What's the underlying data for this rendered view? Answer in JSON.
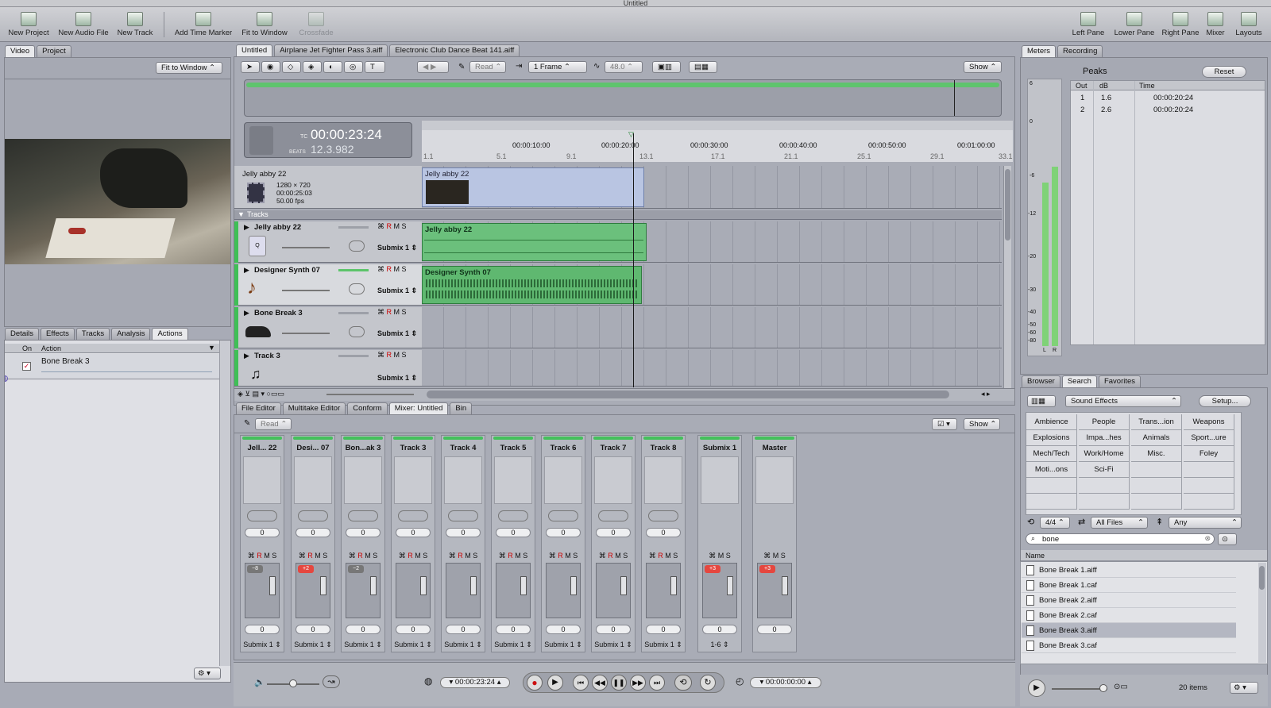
{
  "window": {
    "title": "Untitled"
  },
  "toolbar": [
    {
      "label": "New Project",
      "enabled": true,
      "icon": "new-project-icon"
    },
    {
      "label": "New Audio File",
      "enabled": true,
      "icon": "new-audio-file-icon"
    },
    {
      "label": "New Track",
      "enabled": true,
      "icon": "new-track-icon"
    },
    {
      "label": "Add Time Marker",
      "enabled": true,
      "icon": "time-marker-icon"
    },
    {
      "label": "Fit to Window",
      "enabled": true,
      "icon": "fit-window-icon"
    },
    {
      "label": "Crossfade",
      "enabled": false,
      "icon": "crossfade-icon"
    },
    {
      "label": "Left Pane",
      "enabled": true,
      "icon": "left-pane-icon"
    },
    {
      "label": "Lower Pane",
      "enabled": true,
      "icon": "lower-pane-icon"
    },
    {
      "label": "Right Pane",
      "enabled": true,
      "icon": "right-pane-icon"
    },
    {
      "label": "Mixer",
      "enabled": true,
      "icon": "mixer-icon"
    },
    {
      "label": "Layouts",
      "enabled": true,
      "icon": "layouts-icon"
    }
  ],
  "left_pane": {
    "tabs": [
      "Video",
      "Project"
    ],
    "fit_select": "Fit to Window",
    "lower_tabs": [
      "Details",
      "Effects",
      "Tracks",
      "Analysis",
      "Actions"
    ],
    "actions_header": {
      "on": "On",
      "action": "Action"
    },
    "actions": [
      {
        "name": "Bone Break 3",
        "checked": true
      }
    ]
  },
  "project_tabs": [
    "Untitled",
    "Airplane Jet Fighter Pass 3.aiff",
    "Electronic Club Dance Beat 141.aiff"
  ],
  "timeline_toolbar": {
    "read": "Read",
    "snap": "1 Frame",
    "rate": "48.0",
    "show": "Show"
  },
  "timecode": {
    "tc_label": "TC",
    "tc": "00:00:23:24",
    "beats_label": "BEATS",
    "beats": "12.3.982"
  },
  "ruler": {
    "time": [
      "00:00:10:00",
      "00:00:20:00",
      "00:00:30:00",
      "00:00:40:00",
      "00:00:50:00",
      "00:01:00:00"
    ],
    "beats": [
      "1.1",
      "5.1",
      "9.1",
      "13.1",
      "17.1",
      "21.1",
      "25.1",
      "29.1",
      "33.1"
    ]
  },
  "video_track": {
    "name": "Jelly abby 22",
    "resolution": "1280 × 720",
    "duration": "00:00:25:03",
    "fps": "50.00 fps",
    "clip": "Jelly abby 22"
  },
  "tracks_header": "Tracks",
  "tracks": [
    {
      "name": "Jelly abby 22",
      "bus": "Submix 1",
      "clip": "Jelly abby 22",
      "icon": "movie-icon"
    },
    {
      "name": "Designer Synth  07",
      "bus": "Submix 1",
      "clip": "Designer Synth  07",
      "icon": "violin-icon"
    },
    {
      "name": "Bone Break 3",
      "bus": "Submix 1",
      "clip": "",
      "icon": "shoe-icon"
    },
    {
      "name": "Track 3",
      "bus": "Submix 1",
      "clip": "",
      "icon": "track-icon"
    }
  ],
  "rms": [
    "R",
    "M",
    "S"
  ],
  "lower_tabs": [
    "File Editor",
    "Multitake Editor",
    "Conform",
    "Mixer: Untitled",
    "Bin"
  ],
  "mixer_toolbar": {
    "read": "Read",
    "show": "Show"
  },
  "mixer": [
    {
      "name": "Jell... 22",
      "pan": "0",
      "vol": "0",
      "out": "Submix 1",
      "badge": "−8"
    },
    {
      "name": "Desi...  07",
      "pan": "0",
      "vol": "0",
      "out": "Submix 1",
      "badge": "+2"
    },
    {
      "name": "Bon...ak 3",
      "pan": "0",
      "vol": "0",
      "out": "Submix 1",
      "badge": "−2"
    },
    {
      "name": "Track 3",
      "pan": "0",
      "vol": "0",
      "out": "Submix 1",
      "badge": ""
    },
    {
      "name": "Track 4",
      "pan": "0",
      "vol": "0",
      "out": "Submix 1",
      "badge": ""
    },
    {
      "name": "Track 5",
      "pan": "0",
      "vol": "0",
      "out": "Submix 1",
      "badge": ""
    },
    {
      "name": "Track 6",
      "pan": "0",
      "vol": "0",
      "out": "Submix 1",
      "badge": ""
    },
    {
      "name": "Track 7",
      "pan": "0",
      "vol": "0",
      "out": "Submix 1",
      "badge": ""
    },
    {
      "name": "Track 8",
      "pan": "0",
      "vol": "0",
      "out": "Submix 1",
      "badge": ""
    },
    {
      "name": "Submix 1",
      "pan": "",
      "vol": "0",
      "out": "1-6",
      "badge": "+3"
    },
    {
      "name": "Master",
      "pan": "",
      "vol": "0",
      "out": "",
      "badge": "+3"
    }
  ],
  "transport": {
    "position": "00:00:23:24",
    "end": "00:00:00:00"
  },
  "meters": {
    "tabs": [
      "Meters",
      "Recording"
    ],
    "title": "Peaks",
    "reset": "Reset",
    "scale": [
      "6",
      "0",
      "-6",
      "-12",
      "-20",
      "-30",
      "-40",
      "-50",
      "-60",
      "-80"
    ],
    "channels": [
      "L",
      "R"
    ],
    "peaks_header": [
      "Out",
      "dB",
      "Time"
    ],
    "peaks": [
      {
        "out": "1",
        "db": "1.6",
        "time": "00:00:20:24"
      },
      {
        "out": "2",
        "db": "2.6",
        "time": "00:00:20:24"
      }
    ],
    "levels": [
      0.62,
      0.68
    ]
  },
  "browser": {
    "tabs": [
      "Browser",
      "Search",
      "Favorites"
    ],
    "category": "Sound Effects",
    "setup": "Setup...",
    "categories": [
      "Ambience",
      "People",
      "Trans...ion",
      "Weapons",
      "Explosions",
      "Impa...hes",
      "Animals",
      "Sport...ure",
      "Mech/Tech",
      "Work/Home",
      "Misc.",
      "Foley",
      "Moti...ons",
      "Sci-Fi",
      "",
      ""
    ],
    "time_sig": "4/4",
    "files_filter": "All Files",
    "key": "Any",
    "search": "bone",
    "name_header": "Name",
    "results": [
      {
        "name": "Bone Break 1.aiff",
        "selected": false
      },
      {
        "name": "Bone Break 1.caf",
        "selected": false
      },
      {
        "name": "Bone Break 2.aiff",
        "selected": false
      },
      {
        "name": "Bone Break 2.caf",
        "selected": false
      },
      {
        "name": "Bone Break 3.aiff",
        "selected": true
      },
      {
        "name": "Bone Break 3.caf",
        "selected": false
      }
    ],
    "count": "20 items"
  }
}
